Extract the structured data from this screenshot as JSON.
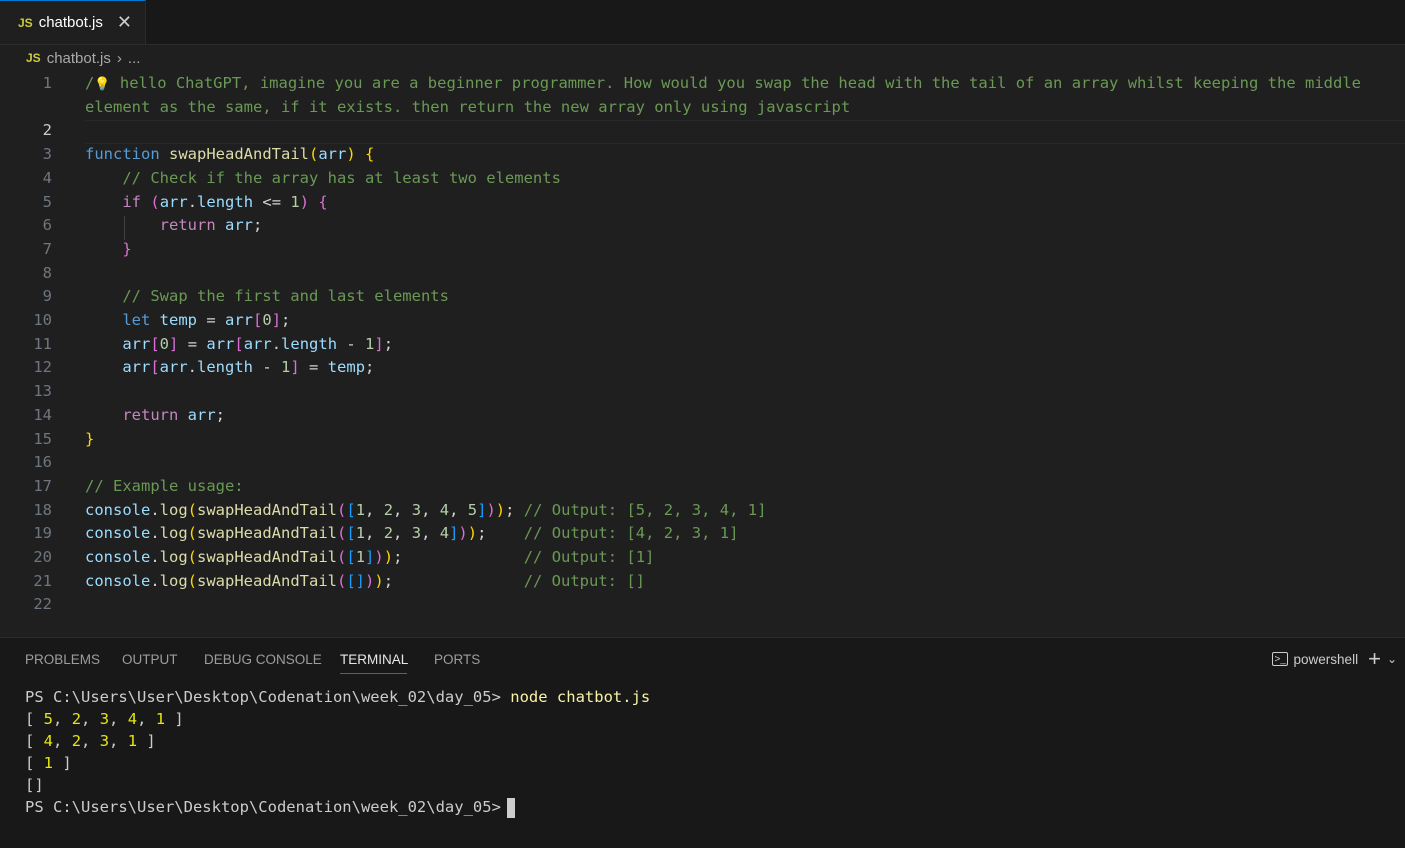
{
  "tab": {
    "badge": "JS",
    "filename": "chatbot.js",
    "close": "✕"
  },
  "breadcrumb": {
    "badge": "JS",
    "file": "chatbot.js",
    "separator": "›",
    "rest": "..."
  },
  "lines": [
    {
      "n": "1",
      "segs": [
        {
          "c": "cm",
          "t": "/"
        },
        {
          "c": "bulb",
          "t": "💡"
        },
        {
          "c": "cm",
          "t": " hello ChatGPT, imagine you are a beginner programmer. How would you swap the head with the tail of an array whilst keeping the middle"
        }
      ]
    },
    {
      "n": "",
      "segs": [
        {
          "c": "cm",
          "t": "element as the same, if it exists. then return the new array only using javascript"
        }
      ]
    },
    {
      "n": "2",
      "segs": []
    },
    {
      "n": "3",
      "segs": [
        {
          "c": "kw",
          "t": "function"
        },
        {
          "c": "tx",
          "t": " "
        },
        {
          "c": "fn",
          "t": "swapHeadAndTail"
        },
        {
          "c": "p1",
          "t": "("
        },
        {
          "c": "var",
          "t": "arr"
        },
        {
          "c": "p1",
          "t": ")"
        },
        {
          "c": "tx",
          "t": " "
        },
        {
          "c": "p1",
          "t": "{"
        }
      ]
    },
    {
      "n": "4",
      "segs": [
        {
          "c": "tx",
          "t": "    "
        },
        {
          "c": "cm",
          "t": "// Check if the array has at least two elements"
        }
      ]
    },
    {
      "n": "5",
      "segs": [
        {
          "c": "tx",
          "t": "    "
        },
        {
          "c": "ctl",
          "t": "if"
        },
        {
          "c": "tx",
          "t": " "
        },
        {
          "c": "p2",
          "t": "("
        },
        {
          "c": "var",
          "t": "arr"
        },
        {
          "c": "tx",
          "t": "."
        },
        {
          "c": "var",
          "t": "length"
        },
        {
          "c": "tx",
          "t": " <= "
        },
        {
          "c": "num",
          "t": "1"
        },
        {
          "c": "p2",
          "t": ")"
        },
        {
          "c": "tx",
          "t": " "
        },
        {
          "c": "p2",
          "t": "{"
        }
      ]
    },
    {
      "n": "6",
      "segs": [
        {
          "c": "tx",
          "t": "        "
        },
        {
          "c": "ctl",
          "t": "return"
        },
        {
          "c": "tx",
          "t": " "
        },
        {
          "c": "var",
          "t": "arr"
        },
        {
          "c": "tx",
          "t": ";"
        }
      ]
    },
    {
      "n": "7",
      "segs": [
        {
          "c": "tx",
          "t": "    "
        },
        {
          "c": "p2",
          "t": "}"
        }
      ]
    },
    {
      "n": "8",
      "segs": []
    },
    {
      "n": "9",
      "segs": [
        {
          "c": "tx",
          "t": "    "
        },
        {
          "c": "cm",
          "t": "// Swap the first and last elements"
        }
      ]
    },
    {
      "n": "10",
      "segs": [
        {
          "c": "tx",
          "t": "    "
        },
        {
          "c": "kw",
          "t": "let"
        },
        {
          "c": "tx",
          "t": " "
        },
        {
          "c": "var",
          "t": "temp"
        },
        {
          "c": "tx",
          "t": " = "
        },
        {
          "c": "var",
          "t": "arr"
        },
        {
          "c": "p2",
          "t": "["
        },
        {
          "c": "num",
          "t": "0"
        },
        {
          "c": "p2",
          "t": "]"
        },
        {
          "c": "tx",
          "t": ";"
        }
      ]
    },
    {
      "n": "11",
      "segs": [
        {
          "c": "tx",
          "t": "    "
        },
        {
          "c": "var",
          "t": "arr"
        },
        {
          "c": "p2",
          "t": "["
        },
        {
          "c": "num",
          "t": "0"
        },
        {
          "c": "p2",
          "t": "]"
        },
        {
          "c": "tx",
          "t": " = "
        },
        {
          "c": "var",
          "t": "arr"
        },
        {
          "c": "p2",
          "t": "["
        },
        {
          "c": "var",
          "t": "arr"
        },
        {
          "c": "tx",
          "t": "."
        },
        {
          "c": "var",
          "t": "length"
        },
        {
          "c": "tx",
          "t": " - "
        },
        {
          "c": "num",
          "t": "1"
        },
        {
          "c": "p2",
          "t": "]"
        },
        {
          "c": "tx",
          "t": ";"
        }
      ]
    },
    {
      "n": "12",
      "segs": [
        {
          "c": "tx",
          "t": "    "
        },
        {
          "c": "var",
          "t": "arr"
        },
        {
          "c": "p2",
          "t": "["
        },
        {
          "c": "var",
          "t": "arr"
        },
        {
          "c": "tx",
          "t": "."
        },
        {
          "c": "var",
          "t": "length"
        },
        {
          "c": "tx",
          "t": " - "
        },
        {
          "c": "num",
          "t": "1"
        },
        {
          "c": "p2",
          "t": "]"
        },
        {
          "c": "tx",
          "t": " = "
        },
        {
          "c": "var",
          "t": "temp"
        },
        {
          "c": "tx",
          "t": ";"
        }
      ]
    },
    {
      "n": "13",
      "segs": []
    },
    {
      "n": "14",
      "segs": [
        {
          "c": "tx",
          "t": "    "
        },
        {
          "c": "ctl",
          "t": "return"
        },
        {
          "c": "tx",
          "t": " "
        },
        {
          "c": "var",
          "t": "arr"
        },
        {
          "c": "tx",
          "t": ";"
        }
      ]
    },
    {
      "n": "15",
      "segs": [
        {
          "c": "p1",
          "t": "}"
        }
      ]
    },
    {
      "n": "16",
      "segs": []
    },
    {
      "n": "17",
      "segs": [
        {
          "c": "cm",
          "t": "// Example usage:"
        }
      ]
    },
    {
      "n": "18",
      "segs": [
        {
          "c": "var",
          "t": "console"
        },
        {
          "c": "tx",
          "t": "."
        },
        {
          "c": "fn",
          "t": "log"
        },
        {
          "c": "p1",
          "t": "("
        },
        {
          "c": "fn",
          "t": "swapHeadAndTail"
        },
        {
          "c": "p2",
          "t": "("
        },
        {
          "c": "p3",
          "t": "["
        },
        {
          "c": "num",
          "t": "1"
        },
        {
          "c": "tx",
          "t": ", "
        },
        {
          "c": "num",
          "t": "2"
        },
        {
          "c": "tx",
          "t": ", "
        },
        {
          "c": "num",
          "t": "3"
        },
        {
          "c": "tx",
          "t": ", "
        },
        {
          "c": "num",
          "t": "4"
        },
        {
          "c": "tx",
          "t": ", "
        },
        {
          "c": "num",
          "t": "5"
        },
        {
          "c": "p3",
          "t": "]"
        },
        {
          "c": "p2",
          "t": ")"
        },
        {
          "c": "p1",
          "t": ")"
        },
        {
          "c": "tx",
          "t": "; "
        },
        {
          "c": "cm",
          "t": "// Output: [5, 2, 3, 4, 1]"
        }
      ]
    },
    {
      "n": "19",
      "segs": [
        {
          "c": "var",
          "t": "console"
        },
        {
          "c": "tx",
          "t": "."
        },
        {
          "c": "fn",
          "t": "log"
        },
        {
          "c": "p1",
          "t": "("
        },
        {
          "c": "fn",
          "t": "swapHeadAndTail"
        },
        {
          "c": "p2",
          "t": "("
        },
        {
          "c": "p3",
          "t": "["
        },
        {
          "c": "num",
          "t": "1"
        },
        {
          "c": "tx",
          "t": ", "
        },
        {
          "c": "num",
          "t": "2"
        },
        {
          "c": "tx",
          "t": ", "
        },
        {
          "c": "num",
          "t": "3"
        },
        {
          "c": "tx",
          "t": ", "
        },
        {
          "c": "num",
          "t": "4"
        },
        {
          "c": "p3",
          "t": "]"
        },
        {
          "c": "p2",
          "t": ")"
        },
        {
          "c": "p1",
          "t": ")"
        },
        {
          "c": "tx",
          "t": ";    "
        },
        {
          "c": "cm",
          "t": "// Output: [4, 2, 3, 1]"
        }
      ]
    },
    {
      "n": "20",
      "segs": [
        {
          "c": "var",
          "t": "console"
        },
        {
          "c": "tx",
          "t": "."
        },
        {
          "c": "fn",
          "t": "log"
        },
        {
          "c": "p1",
          "t": "("
        },
        {
          "c": "fn",
          "t": "swapHeadAndTail"
        },
        {
          "c": "p2",
          "t": "("
        },
        {
          "c": "p3",
          "t": "["
        },
        {
          "c": "num",
          "t": "1"
        },
        {
          "c": "p3",
          "t": "]"
        },
        {
          "c": "p2",
          "t": ")"
        },
        {
          "c": "p1",
          "t": ")"
        },
        {
          "c": "tx",
          "t": ";             "
        },
        {
          "c": "cm",
          "t": "// Output: [1]"
        }
      ]
    },
    {
      "n": "21",
      "segs": [
        {
          "c": "var",
          "t": "console"
        },
        {
          "c": "tx",
          "t": "."
        },
        {
          "c": "fn",
          "t": "log"
        },
        {
          "c": "p1",
          "t": "("
        },
        {
          "c": "fn",
          "t": "swapHeadAndTail"
        },
        {
          "c": "p2",
          "t": "("
        },
        {
          "c": "p3",
          "t": "[]"
        },
        {
          "c": "p2",
          "t": ")"
        },
        {
          "c": "p1",
          "t": ")"
        },
        {
          "c": "tx",
          "t": ";              "
        },
        {
          "c": "cm",
          "t": "// Output: []"
        }
      ]
    },
    {
      "n": "22",
      "segs": []
    }
  ],
  "panel": {
    "tabs": [
      "PROBLEMS",
      "OUTPUT",
      "DEBUG CONSOLE",
      "TERMINAL",
      "PORTS"
    ],
    "active_tab": "TERMINAL",
    "shell_name": "powershell",
    "new_terminal": "+",
    "dropdown": "⌄"
  },
  "terminal": {
    "prompt": "PS C:\\Users\\User\\Desktop\\Codenation\\week_02\\day_05>",
    "command": "node chatbot.js",
    "outputs": [
      [
        {
          "c": "t",
          "t": "[ "
        },
        {
          "c": "n",
          "t": "5"
        },
        {
          "c": "t",
          "t": ", "
        },
        {
          "c": "n",
          "t": "2"
        },
        {
          "c": "t",
          "t": ", "
        },
        {
          "c": "n",
          "t": "3"
        },
        {
          "c": "t",
          "t": ", "
        },
        {
          "c": "n",
          "t": "4"
        },
        {
          "c": "t",
          "t": ", "
        },
        {
          "c": "n",
          "t": "1"
        },
        {
          "c": "t",
          "t": " ]"
        }
      ],
      [
        {
          "c": "t",
          "t": "[ "
        },
        {
          "c": "n",
          "t": "4"
        },
        {
          "c": "t",
          "t": ", "
        },
        {
          "c": "n",
          "t": "2"
        },
        {
          "c": "t",
          "t": ", "
        },
        {
          "c": "n",
          "t": "3"
        },
        {
          "c": "t",
          "t": ", "
        },
        {
          "c": "n",
          "t": "1"
        },
        {
          "c": "t",
          "t": " ]"
        }
      ],
      [
        {
          "c": "t",
          "t": "[ "
        },
        {
          "c": "n",
          "t": "1"
        },
        {
          "c": "t",
          "t": " ]"
        }
      ],
      [
        {
          "c": "t",
          "t": "[]"
        }
      ]
    ]
  }
}
